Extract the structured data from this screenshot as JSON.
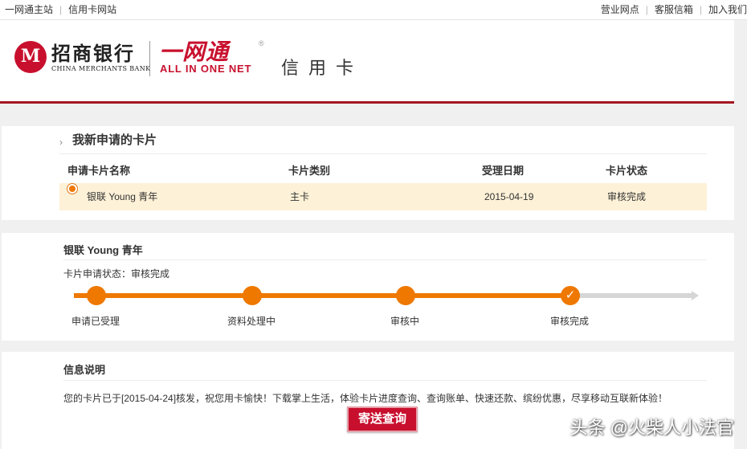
{
  "topbar": {
    "left_links": [
      "一网通主站",
      "信用卡网站"
    ],
    "right_links": [
      "营业网点",
      "客服信箱",
      "加入我们"
    ]
  },
  "header": {
    "bank_name_cn": "招商银行",
    "bank_name_en": "CHINA MERCHANTS BANK",
    "logo_mark": "M",
    "aion_cn": "一网通",
    "aion_en": "ALL IN ONE NET",
    "registered_mark": "®",
    "section_title": "信用卡"
  },
  "cards_panel": {
    "title": "我新申请的卡片",
    "columns": [
      "申请卡片名称",
      "卡片类别",
      "受理日期",
      "卡片状态"
    ],
    "rows": [
      {
        "name": "银联 Young 青年",
        "type": "主卡",
        "date": "2015-04-19",
        "status": "审核完成"
      }
    ]
  },
  "progress_panel": {
    "card_name": "银联 Young 青年",
    "status_text": "卡片申请状态：审核完成",
    "steps": [
      "申请已受理",
      "资料处理中",
      "审核中",
      "审核完成"
    ],
    "completed_steps": 4,
    "check_glyph": "✓"
  },
  "info_panel": {
    "title": "信息说明",
    "message": "您的卡片已于[2015-04-24]核发，祝您用卡愉快！下载掌上生活，体验卡片进度查询、查询账单、快速还款、缤纷优惠，尽享移动互联新体验！",
    "button_label": "寄送查询"
  },
  "watermark": "头条 @火柴人小法官",
  "colors": {
    "brand_red": "#c8102e",
    "progress_orange": "#ee7800",
    "row_highlight": "#fdf1d7"
  }
}
